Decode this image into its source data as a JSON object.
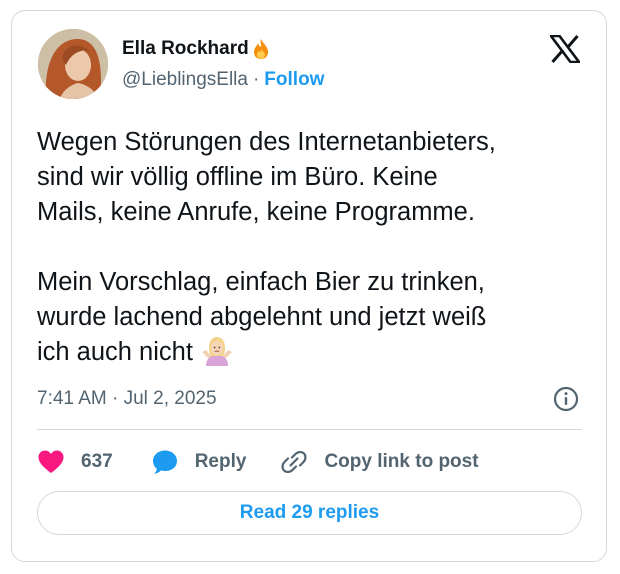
{
  "author": {
    "name": "Ella Rockhard",
    "name_emoji": "fire-icon",
    "handle": "@LieblingsElla",
    "separator": "·",
    "follow_label": "Follow"
  },
  "tweet": {
    "text": "Wegen Störungen des Internetanbieters,\nsind wir völlig offline im Büro. Keine\nMails, keine Anrufe, keine Programme.\n\nMein Vorschlag, einfach Bier zu trinken,\nwurde lachend abgelehnt und jetzt weiß\nich auch nicht",
    "trailing_emoji": "woman-shrugging-icon",
    "timestamp": "7:41 AM · Jul 2, 2025"
  },
  "actions": {
    "like_count": "637",
    "reply_label": "Reply",
    "copy_link_label": "Copy link to post"
  },
  "read_replies_label": "Read 29 replies",
  "colors": {
    "accent": "#1d9bf0",
    "like": "#f91880",
    "text": "#0f1419",
    "secondary": "#536471",
    "border": "#cfd9de"
  }
}
